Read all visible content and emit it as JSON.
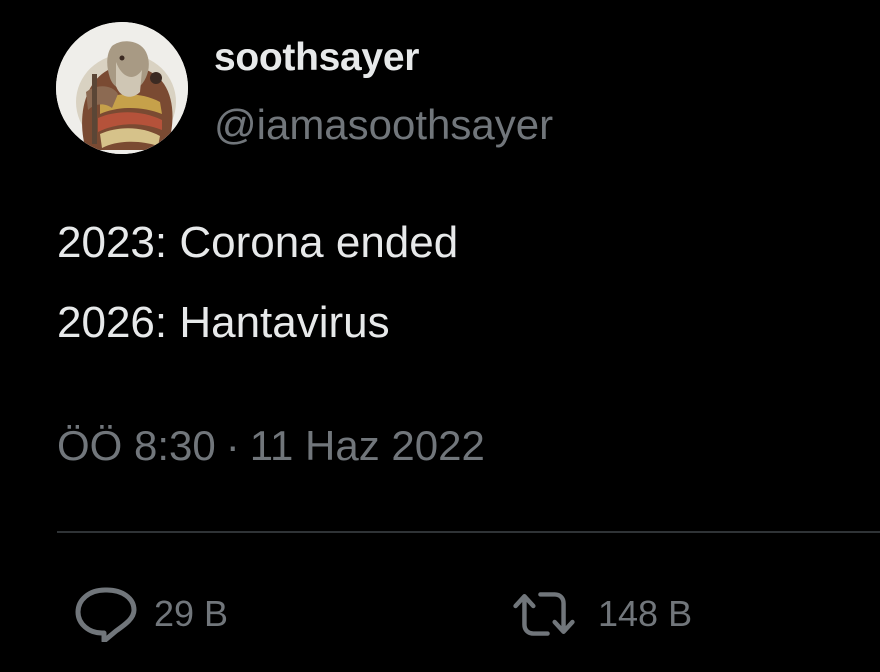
{
  "author": {
    "display_name": "soothsayer",
    "handle": "@iamasoothsayer",
    "avatar_icon": "soothsayer-avatar"
  },
  "tweet": {
    "lines": [
      "2023: Corona ended",
      "2026: Hantavirus"
    ],
    "time": "ÖÖ 8:30",
    "separator": "·",
    "date": "11 Haz 2022"
  },
  "actions": {
    "reply": {
      "icon": "reply-icon",
      "count": "29 B"
    },
    "retweet": {
      "icon": "retweet-icon",
      "count": "148 B"
    }
  },
  "colors": {
    "background": "#000000",
    "primary_text": "#e7e9ea",
    "secondary_text": "#71767b",
    "divider": "#2f3336"
  }
}
